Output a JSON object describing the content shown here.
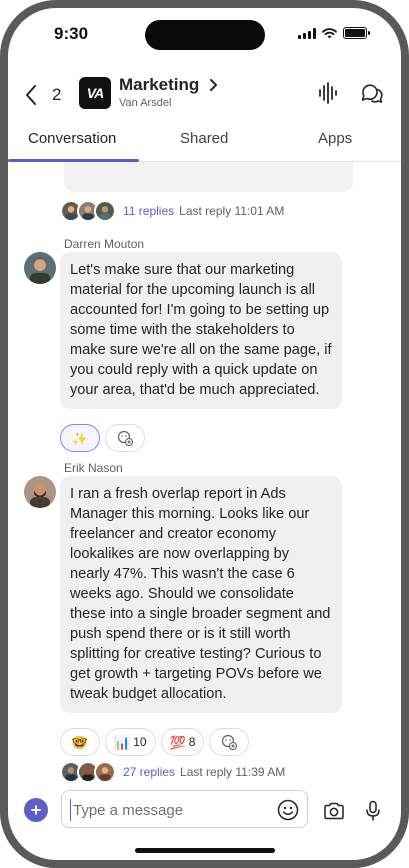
{
  "status": {
    "time": "9:30"
  },
  "header": {
    "back_count": "2",
    "team_logo": "VA",
    "team_name": "Marketing",
    "team_subtitle": "Van Arsdel",
    "icons": [
      "back-chevron-icon",
      "chevron-right-icon",
      "audio-call-icon",
      "chat-icon"
    ]
  },
  "tabs": [
    {
      "label": "Conversation",
      "active": true
    },
    {
      "label": "Shared",
      "active": false
    },
    {
      "label": "Apps",
      "active": false
    }
  ],
  "thread1": {
    "reply_count": "11 replies",
    "last_reply": "Last reply 11:01 AM"
  },
  "message1": {
    "sender": "Darren Mouton",
    "text": "Let's make sure that our marketing material for the upcoming launch is all accounted for! I'm going to be setting up some time with the stakeholders to make sure we're all on the same page, if you could reply with a quick update on your area, that'd be much appreciated.",
    "reactions": [
      {
        "emoji": "✨",
        "count": "",
        "selected": true
      },
      {
        "emoji": "add-reaction-icon",
        "count": ""
      }
    ]
  },
  "message2": {
    "sender": "Erik Nason",
    "text": "I ran a fresh overlap report in Ads Manager this morning. Looks like our freelancer and creator economy lookalikes are now overlapping by nearly 47%. This wasn't the case 6 weeks ago. Should we consolidate these into a single broader segment and push spend there or is it still worth splitting for creative testing? Curious to get growth + targeting POVs before we tweak budget allocation.",
    "reactions": [
      {
        "emoji": "🤓",
        "count": ""
      },
      {
        "emoji": "📊",
        "count": "10"
      },
      {
        "emoji": "💯",
        "count": "8"
      },
      {
        "emoji": "add-reaction-icon",
        "count": ""
      }
    ]
  },
  "thread2": {
    "reply_count": "27 replies",
    "last_reply": "Last reply 11:39 AM"
  },
  "composer": {
    "placeholder": "Type a message"
  },
  "colors": {
    "accent": "#5b5fc7",
    "bubble": "#f0f0f0"
  }
}
